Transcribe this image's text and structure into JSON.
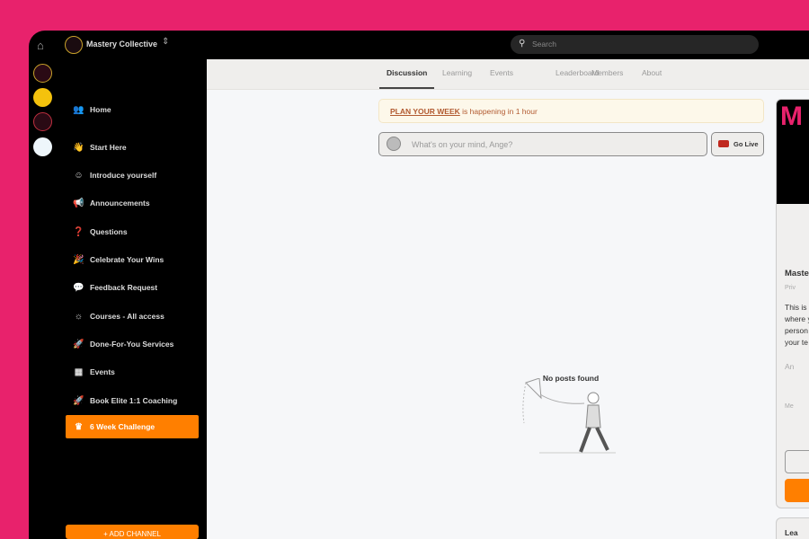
{
  "header": {
    "community": "Mastery Collective",
    "search_placeholder": "Search"
  },
  "sidebar": {
    "items": [
      {
        "icon": "👥",
        "label": "Home"
      },
      {
        "icon": "👋",
        "label": "Start Here"
      },
      {
        "icon": "☺",
        "label": "Introduce yourself"
      },
      {
        "icon": "📢",
        "label": "Announcements"
      },
      {
        "icon": "❓",
        "label": "Questions"
      },
      {
        "icon": "🎉",
        "label": "Celebrate Your Wins"
      },
      {
        "icon": "💬",
        "label": "Feedback Request"
      },
      {
        "icon": "☼",
        "label": "Courses - All access"
      },
      {
        "icon": "🚀",
        "label": "Done-For-You Services"
      },
      {
        "icon": "▦",
        "label": "Events"
      },
      {
        "icon": "🚀",
        "label": "Book Elite 1:1 Coaching"
      },
      {
        "icon": "♛",
        "label": "6 Week Challenge"
      }
    ],
    "add_channel": "+ ADD CHANNEL"
  },
  "tabs": [
    "Discussion",
    "Learning",
    "Events",
    "Leaderboard",
    "Members",
    "About"
  ],
  "banner": {
    "event": "PLAN YOUR WEEK",
    "text": " is happening in 1 hour"
  },
  "composer": {
    "placeholder": "What's on your mind, Ange?",
    "go_live": "Go Live"
  },
  "empty_state": "No posts found",
  "right_panel": {
    "hero": "M",
    "title": "Maste",
    "privacy": "Priv",
    "desc": [
      "This is",
      "where y",
      "person",
      "your te"
    ],
    "link": "An",
    "members": "Me",
    "leaderboard": "Lea"
  }
}
